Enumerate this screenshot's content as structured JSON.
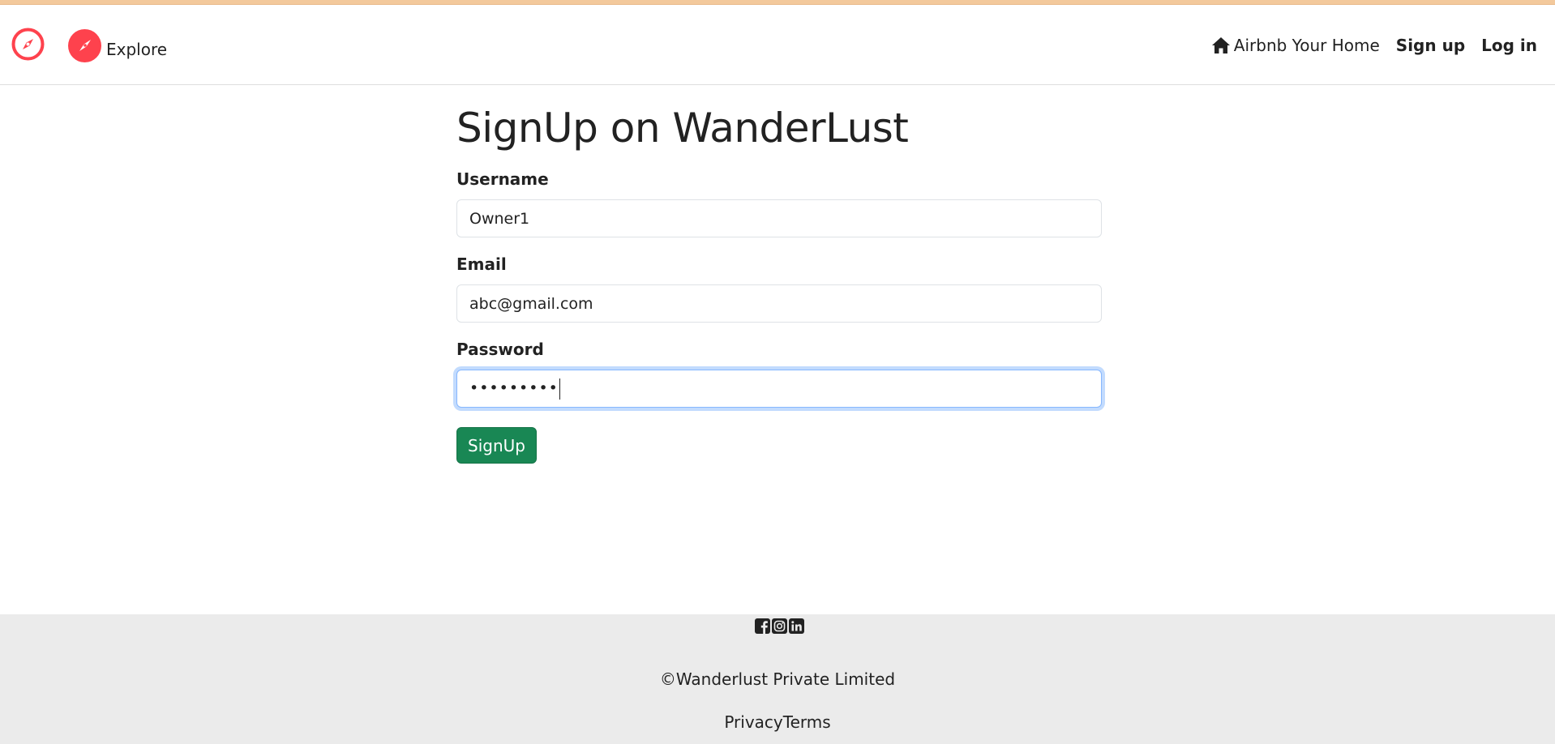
{
  "colors": {
    "brand": "#fe424d",
    "success": "#198754",
    "focus_ring": "#86b7fe",
    "footer_bg": "#ebebeb",
    "text": "#222222"
  },
  "navbar": {
    "brand_icon": "compass-icon",
    "explore_icon": "compass-icon",
    "explore_label": "Explore",
    "host_icon": "home-icon",
    "host_label": "Airbnb Your Home",
    "signup_label": "Sign up",
    "login_label": "Log in"
  },
  "main": {
    "title": "SignUp on WanderLust",
    "username": {
      "label": "Username",
      "value": "Owner1"
    },
    "email": {
      "label": "Email",
      "value": "abc@gmail.com"
    },
    "password": {
      "label": "Password",
      "masked_value": "•••••••••"
    },
    "submit_label": "SignUp"
  },
  "footer": {
    "social_icons": [
      "facebook-icon",
      "instagram-icon",
      "linkedin-icon"
    ],
    "copyright": "©Wanderlust Private Limited",
    "privacy_label": "Privacy",
    "terms_label": "Terms"
  }
}
